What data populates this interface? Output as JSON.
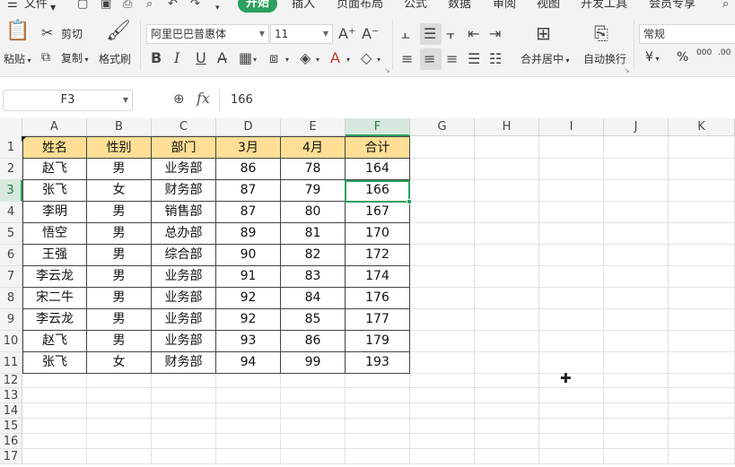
{
  "menubar": {
    "hamburger_icon": "menu-icon",
    "file": "文件",
    "tabs": [
      "开始",
      "插入",
      "页面布局",
      "公式",
      "数据",
      "审阅",
      "视图",
      "开发工具",
      "会员专享"
    ],
    "active_tab": "开始"
  },
  "ribbon": {
    "paste": "粘贴",
    "cut": "剪切",
    "copy": "复制",
    "format_painter": "格式刷",
    "font_name": "阿里巴巴普惠体",
    "font_size": "11",
    "merge_center": "合并居中",
    "wrap_text": "自动换行",
    "number_format": "常规",
    "currency_symbol": "¥",
    "percent_symbol": "%",
    "thousands_symbol": "000"
  },
  "formula_bar": {
    "name_box": "F3",
    "fx": "fx",
    "value": "166"
  },
  "sheet": {
    "columns": [
      "A",
      "B",
      "C",
      "D",
      "E",
      "F",
      "G",
      "H",
      "I",
      "J",
      "K"
    ],
    "selected_column": "F",
    "selected_row": "3",
    "row_numbers": [
      "1",
      "2",
      "3",
      "4",
      "5",
      "6",
      "7",
      "8",
      "9",
      "10",
      "11",
      "12",
      "13",
      "14",
      "15",
      "16",
      "17"
    ],
    "header": [
      "姓名",
      "性别",
      "部门",
      "3月",
      "4月",
      "合计"
    ],
    "rows": [
      [
        "赵飞",
        "男",
        "业务部",
        "86",
        "78",
        "164"
      ],
      [
        "张飞",
        "女",
        "财务部",
        "87",
        "79",
        "166"
      ],
      [
        "李明",
        "男",
        "销售部",
        "87",
        "80",
        "167"
      ],
      [
        "悟空",
        "男",
        "总办部",
        "89",
        "81",
        "170"
      ],
      [
        "王强",
        "男",
        "综合部",
        "90",
        "82",
        "172"
      ],
      [
        "李云龙",
        "男",
        "业务部",
        "91",
        "83",
        "174"
      ],
      [
        "宋二牛",
        "男",
        "业务部",
        "92",
        "84",
        "176"
      ],
      [
        "李云龙",
        "男",
        "业务部",
        "92",
        "85",
        "177"
      ],
      [
        "赵飞",
        "男",
        "业务部",
        "93",
        "86",
        "179"
      ],
      [
        "张飞",
        "女",
        "财务部",
        "94",
        "99",
        "193"
      ]
    ],
    "header_fill_color": "#ffdf96",
    "selection_color": "#2aa05c"
  }
}
